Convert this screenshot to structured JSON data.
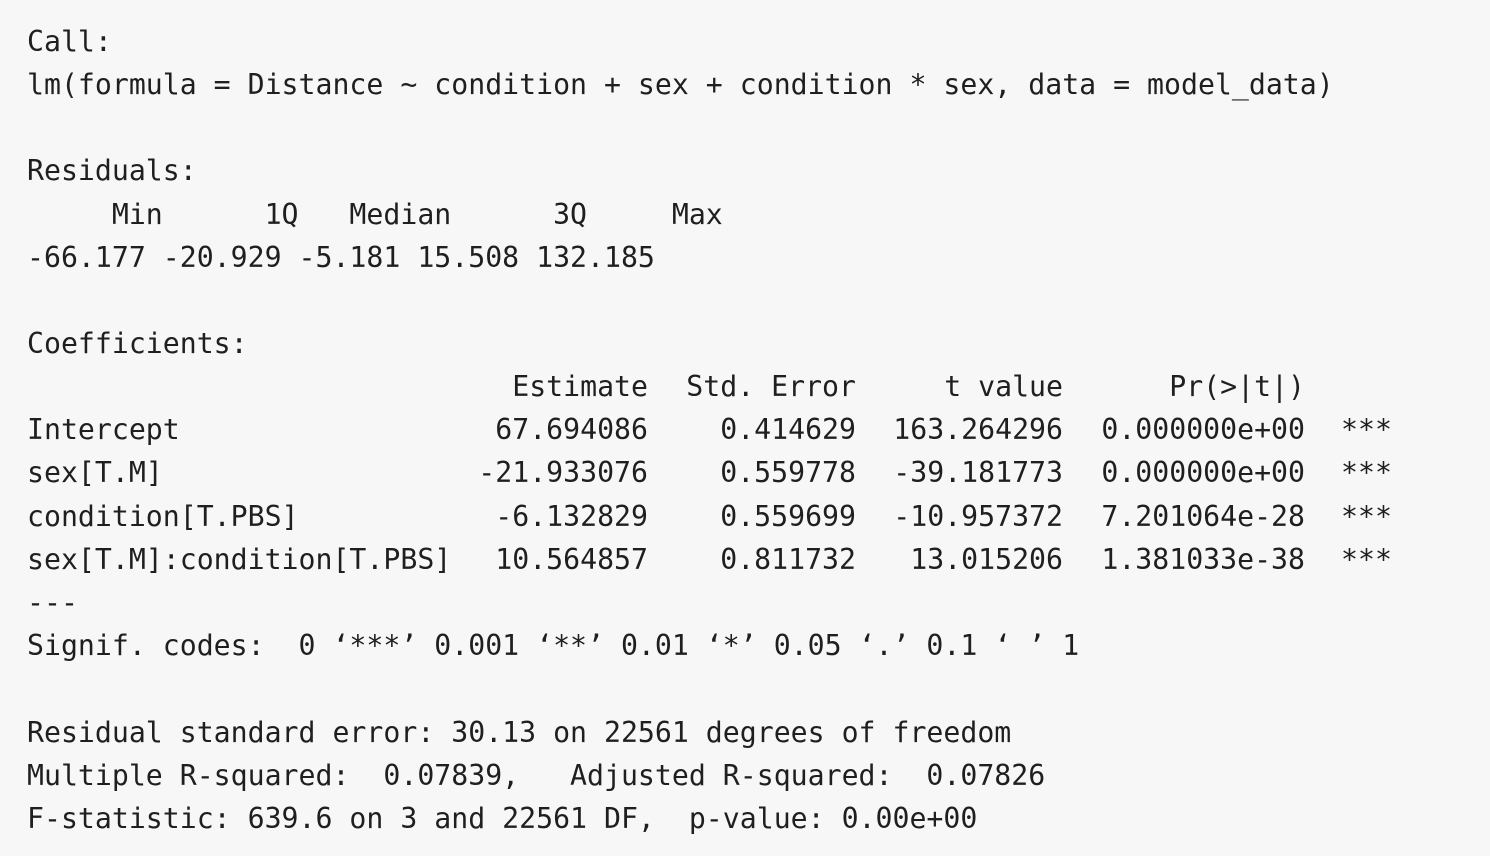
{
  "call_label": "Call:",
  "call_text": "lm(formula = Distance ~ condition + sex + condition * sex, data = model_data)",
  "residuals_label": "Residuals:",
  "residuals_header": "     Min      1Q   Median      3Q     Max",
  "residuals_values": "-66.177 -20.929 -5.181 15.508 132.185",
  "coefficients_label": "Coefficients:",
  "coef_headers": {
    "estimate": "Estimate",
    "std_error": "Std. Error",
    "t_value": "t value",
    "p_value": "Pr(>|t|)"
  },
  "coef_rows": [
    {
      "term": "Intercept",
      "estimate": "67.694086",
      "std_error": "0.414629",
      "t_value": "163.264296",
      "p_value": "0.000000e+00",
      "signif": "***"
    },
    {
      "term": "sex[T.M]",
      "estimate": "-21.933076",
      "std_error": "0.559778",
      "t_value": "-39.181773",
      "p_value": "0.000000e+00",
      "signif": "***"
    },
    {
      "term": "condition[T.PBS]",
      "estimate": "-6.132829",
      "std_error": "0.559699",
      "t_value": "-10.957372",
      "p_value": "7.201064e-28",
      "signif": "***"
    },
    {
      "term": "sex[T.M]:condition[T.PBS]",
      "estimate": "10.564857",
      "std_error": "0.811732",
      "t_value": "13.015206",
      "p_value": "1.381033e-38",
      "signif": "***"
    }
  ],
  "separator": "---",
  "signif_codes": "Signif. codes:  0 ‘***’ 0.001 ‘**’ 0.01 ‘*’ 0.05 ‘.’ 0.1 ‘ ’ 1",
  "residual_std_error": "Residual standard error: 30.13 on 22561 degrees of freedom",
  "r_squared": "Multiple R-squared:  0.07839,   Adjusted R-squared:  0.07826",
  "f_statistic": "F-statistic: 639.6 on 3 and 22561 DF,  p-value: 0.00e+00"
}
